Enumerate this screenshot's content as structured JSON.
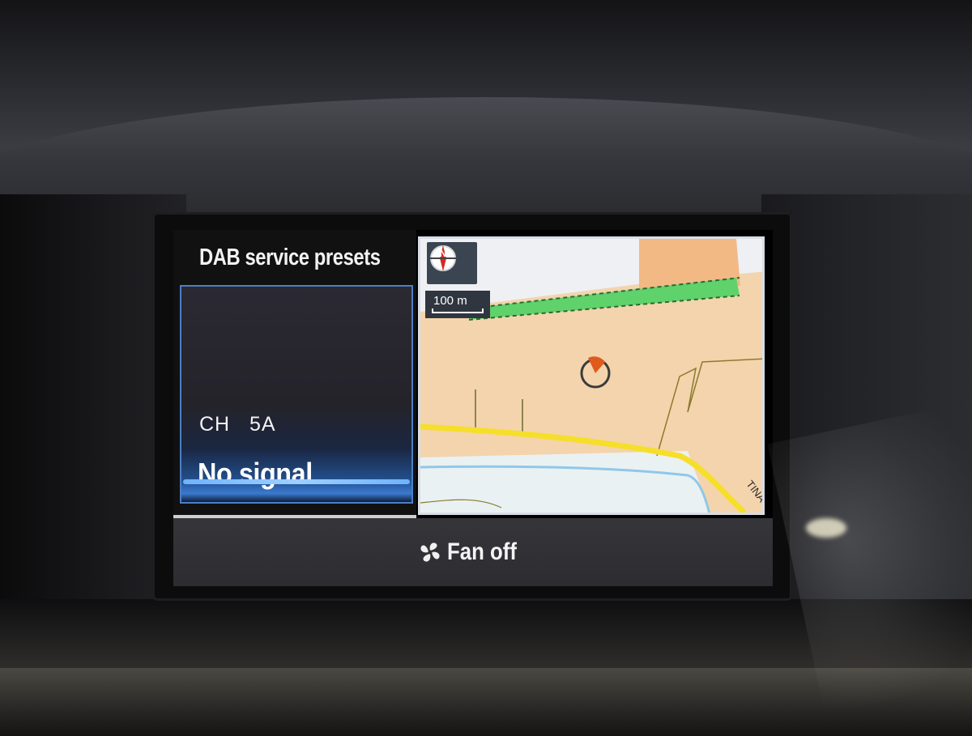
{
  "audio": {
    "title": "DAB service presets",
    "channel": "CH   5A",
    "signal_status": "No signal"
  },
  "map": {
    "compass_letter": "N",
    "scale_label": "100 m",
    "road_label": "TINA"
  },
  "status_bar": {
    "fan_icon": "fan-icon",
    "fan_label": "Fan off"
  },
  "colors": {
    "selection_border": "#4c7fc5",
    "map_land": "#f4d4ac",
    "map_main_road": "#f5df2a",
    "map_park": "#5fd26b",
    "map_water": "#8fc8e8",
    "vehicle_marker": "#e05a1c"
  }
}
